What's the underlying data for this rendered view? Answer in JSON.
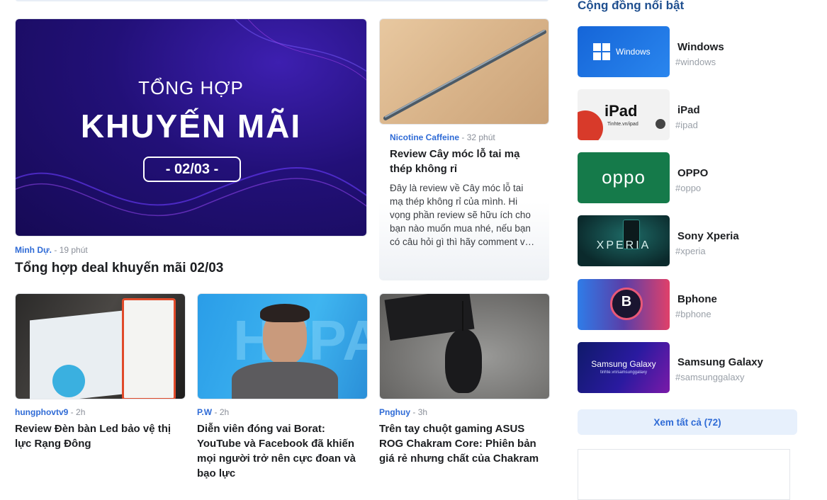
{
  "featured": {
    "image_text": {
      "line1": "TỔNG HỢP",
      "line2": "KHUYẾN MÃI",
      "date": "- 02/03 -"
    },
    "author": "Minh Dự.",
    "time": "19 phút",
    "title": "Tổng hợp deal khuyến mãi 02/03"
  },
  "side_article": {
    "author": "Nicotine Caffeine",
    "time": "32 phút",
    "title": "Review Cây móc lỗ tai mạ thép không rỉ",
    "excerpt": "Đây là review về Cây móc lỗ tai mạ thép không rỉ của mình. Hi vọng phần review sẽ hữu ích cho bạn nào muốn mua nhé, nếu bạn có câu hỏi gì thì hãy comment v…"
  },
  "articles": [
    {
      "author": "hungphovtv9",
      "time": "2h",
      "title": "Review Đèn bàn Led bảo vệ thị lực Rạng Đông"
    },
    {
      "author": "P.W",
      "time": "2h",
      "title": "Diễn viên đóng vai Borat: YouTube và Facebook đã khiến mọi người trở nên cực đoan và bạo lực"
    },
    {
      "author": "Pnghuy",
      "time": "3h",
      "title": "Trên tay chuột gaming ASUS ROG Chakram Core: Phiên bản giá rẻ nhưng chất của Chakram"
    }
  ],
  "separator": "-",
  "communities": {
    "heading": "Cộng đồng nổi bật",
    "items": [
      {
        "name": "Windows",
        "tag": "#windows",
        "thumb_text": "Windows",
        "color": "#1e73d8"
      },
      {
        "name": "iPad",
        "tag": "#ipad",
        "thumb_text": "iPad",
        "thumb_sub": "Tinhte.vn/ipad",
        "color": "#f3f3f3"
      },
      {
        "name": "OPPO",
        "tag": "#oppo",
        "thumb_text": "oppo",
        "color": "#1a7a4c"
      },
      {
        "name": "Sony Xperia",
        "tag": "#xperia",
        "thumb_text": "XPERIA",
        "color": "#0f3a3a"
      },
      {
        "name": "Bphone",
        "tag": "#bphone",
        "thumb_text": "B",
        "color": "#2a6ad6"
      },
      {
        "name": "Samsung Galaxy",
        "tag": "#samsunggalaxy",
        "thumb_text": "Samsung Galaxy",
        "thumb_sub": "tinhte.vn/samsunggalaxy",
        "color": "#1a2a8a"
      }
    ],
    "see_all": "Xem tất cả (72)"
  }
}
